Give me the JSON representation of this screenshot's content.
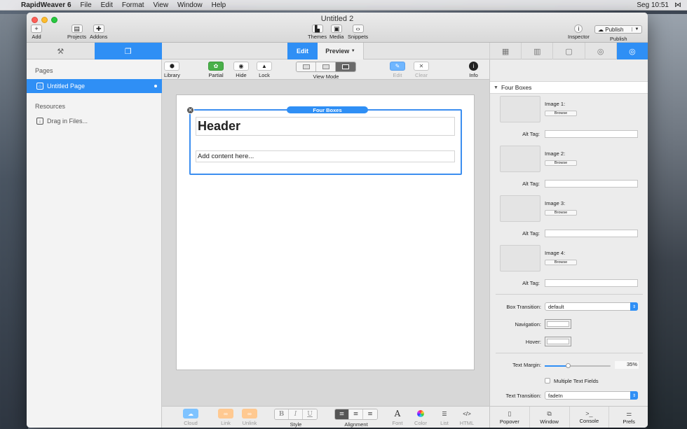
{
  "menubar": {
    "app_name": "RapidWeaver 6",
    "items": [
      "File",
      "Edit",
      "Format",
      "View",
      "Window",
      "Help"
    ],
    "clock": "Seg 10:51"
  },
  "window": {
    "title": "Untitled 2"
  },
  "toolbar": {
    "add_label": "Add",
    "projects_label": "Projects",
    "addons_label": "Addons",
    "themes_label": "Themes",
    "media_label": "Media",
    "snippets_label": "Snippets",
    "inspector_label": "Inspector",
    "publish_button_label": "Publish",
    "publish_label": "Publish"
  },
  "tabs": {
    "edit": "Edit",
    "preview": "Preview"
  },
  "sidebar": {
    "pages_heading": "Pages",
    "pages": [
      {
        "label": "Untitled Page"
      }
    ],
    "resources_heading": "Resources",
    "drag_in_files": "Drag in Files..."
  },
  "editor_toolbar": {
    "library": "Library",
    "partial": "Partial",
    "hide": "Hide",
    "lock": "Lock",
    "view_mode": "View Mode",
    "edit": "Edit",
    "clear": "Clear",
    "info": "Info"
  },
  "stack": {
    "tag": "Four Boxes",
    "header_text": "Header",
    "content_text": "Add content here..."
  },
  "bottom_toolbar": {
    "cloud": "Cloud",
    "link": "Link",
    "unlink": "Unlink",
    "style": "Style",
    "style_buttons": [
      "B",
      "I",
      "U"
    ],
    "alignment": "Alignment",
    "font": "Font",
    "color": "Color",
    "list": "List",
    "html": "HTML"
  },
  "inspector": {
    "section_title": "Four Boxes",
    "images": [
      {
        "label": "Image 1:",
        "browse": "Browse",
        "alt_label": "Alt Tag:",
        "alt_value": ""
      },
      {
        "label": "Image 2:",
        "browse": "Browse",
        "alt_label": "Alt Tag:",
        "alt_value": ""
      },
      {
        "label": "Image 3:",
        "browse": "Browse",
        "alt_label": "Alt Tag:",
        "alt_value": ""
      },
      {
        "label": "Image 4:",
        "browse": "Browse",
        "alt_label": "Alt Tag:",
        "alt_value": ""
      }
    ],
    "box_transition_label": "Box Transition:",
    "box_transition_value": "default",
    "navigation_label": "Navigation:",
    "hover_label": "Hover:",
    "text_margin_label": "Text Margin:",
    "text_margin_value": "35%",
    "text_margin_fraction": 0.35,
    "multiple_text_fields_label": "Multiple Text Fields",
    "text_transition_label": "Text Transition:",
    "text_transition_value": "fadeIn",
    "bottom": {
      "popover": "Popover",
      "window": "Window",
      "console": "Console",
      "prefs": "Prefs"
    }
  },
  "colors": {
    "accent": "#2f8ff5",
    "partial_green": "#4ab04a",
    "link_orange": "#ffc991"
  }
}
